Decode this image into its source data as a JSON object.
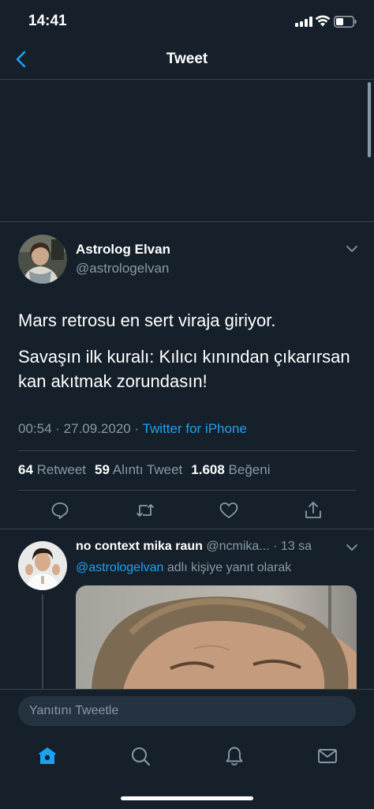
{
  "status_bar": {
    "time": "14:41"
  },
  "header": {
    "title": "Tweet"
  },
  "tweet": {
    "author_name": "Astrolog Elvan",
    "author_handle": "@astrologelvan",
    "text_line1": "Mars retrosu en sert viraja giriyor.",
    "text_line2": "Savaşın ilk kuralı: Kılıcı kınından çıkarırsan kan akıtmak zorundasın!",
    "time": "00:54",
    "date": "27.09.2020",
    "source": "Twitter for iPhone",
    "retweet_count": "64",
    "retweet_label": "Retweet",
    "quote_count": "59",
    "quote_label": "Alıntı Tweet",
    "like_count": "1.608",
    "like_label": "Beğeni"
  },
  "reply": {
    "author_name": "no context mika raun",
    "author_handle": "@ncmika...",
    "time": "· 13 sa",
    "mention": "@astrologelvan",
    "reply_suffix": "adlı kişiye yanıt olarak"
  },
  "composer": {
    "placeholder": "Yanıtını Tweetle"
  },
  "icons": {
    "back": "chevron-left-icon",
    "caret": "chevron-down-icon",
    "reply": "comment-icon",
    "retweet": "retweet-icon",
    "like": "heart-icon",
    "share": "share-icon",
    "tabs": [
      "home-icon",
      "search-icon",
      "notifications-icon",
      "messages-icon"
    ]
  },
  "colors": {
    "background": "#15202b",
    "accent": "#1da1f2",
    "secondary_text": "#8899a6",
    "divider": "#38444d"
  }
}
